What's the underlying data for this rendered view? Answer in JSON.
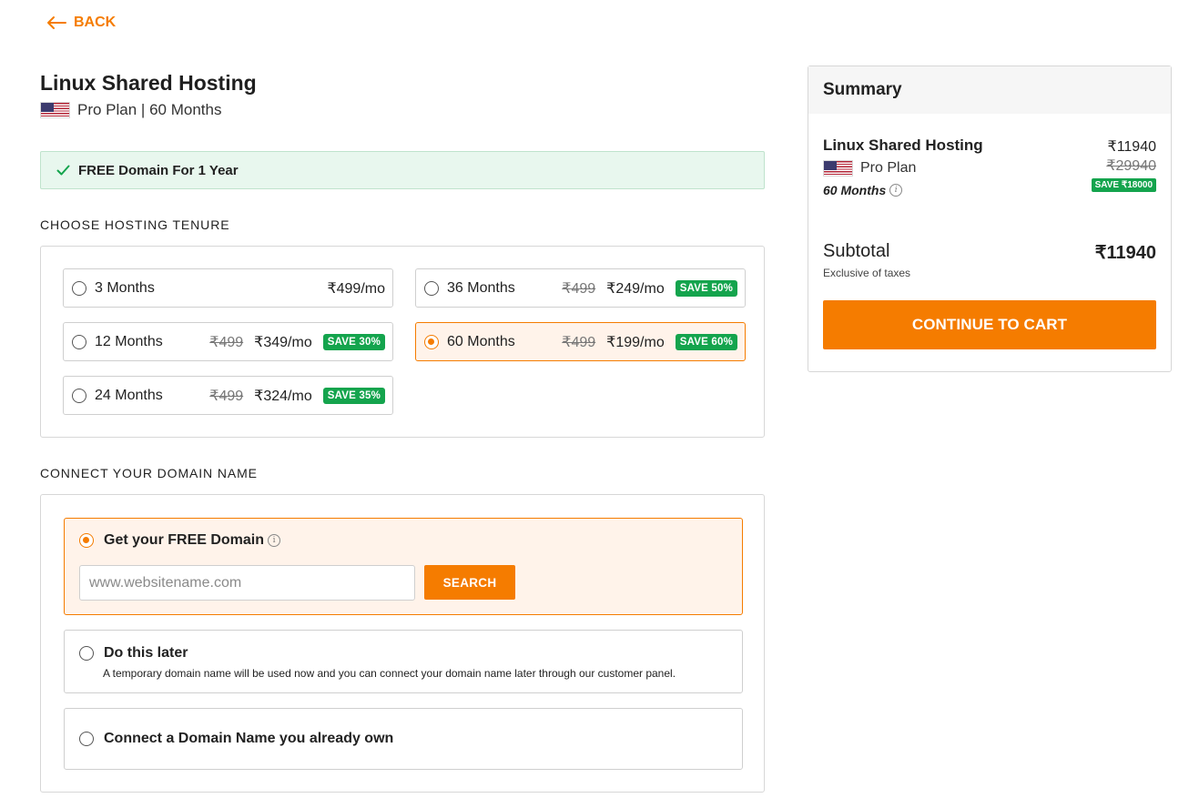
{
  "nav": {
    "back_label": "BACK"
  },
  "product": {
    "title": "Linux Shared Hosting",
    "subtitle": "Pro Plan | 60 Months"
  },
  "banner": {
    "text": "FREE Domain For 1 Year"
  },
  "tenure": {
    "section_label": "CHOOSE HOSTING TENURE",
    "options": [
      {
        "months": "3 Months",
        "old_price": "",
        "price": "₹499/mo",
        "badge": "",
        "selected": false
      },
      {
        "months": "36 Months",
        "old_price": "₹499",
        "price": "₹249/mo",
        "badge": "SAVE 50%",
        "selected": false
      },
      {
        "months": "12 Months",
        "old_price": "₹499",
        "price": "₹349/mo",
        "badge": "SAVE 30%",
        "selected": false
      },
      {
        "months": "60 Months",
        "old_price": "₹499",
        "price": "₹199/mo",
        "badge": "SAVE 60%",
        "selected": true
      },
      {
        "months": "24 Months",
        "old_price": "₹499",
        "price": "₹324/mo",
        "badge": "SAVE 35%",
        "selected": false
      }
    ]
  },
  "domain": {
    "section_label": "CONNECT YOUR DOMAIN NAME",
    "free_option": {
      "label": "Get your FREE Domain",
      "input_placeholder": "www.websitename.com",
      "search_label": "SEARCH",
      "selected": true
    },
    "later_option": {
      "label": "Do this later",
      "description": "A temporary domain name will be used now and you can connect your domain name later through our customer panel."
    },
    "own_option": {
      "label": "Connect a Domain Name you already own"
    }
  },
  "summary": {
    "heading": "Summary",
    "item_title": "Linux Shared Hosting",
    "price": "₹11940",
    "old_price": "₹29940",
    "plan": "Pro Plan",
    "save_badge": "SAVE ₹18000",
    "duration": "60 Months",
    "subtotal_label": "Subtotal",
    "subtotal_value": "₹11940",
    "tax_note": "Exclusive of taxes",
    "cta_label": "CONTINUE TO CART"
  },
  "colors": {
    "accent": "#f57c00",
    "save_green": "#14a44d",
    "banner_bg": "#e8f7ee",
    "selected_bg": "#fff3ea"
  }
}
